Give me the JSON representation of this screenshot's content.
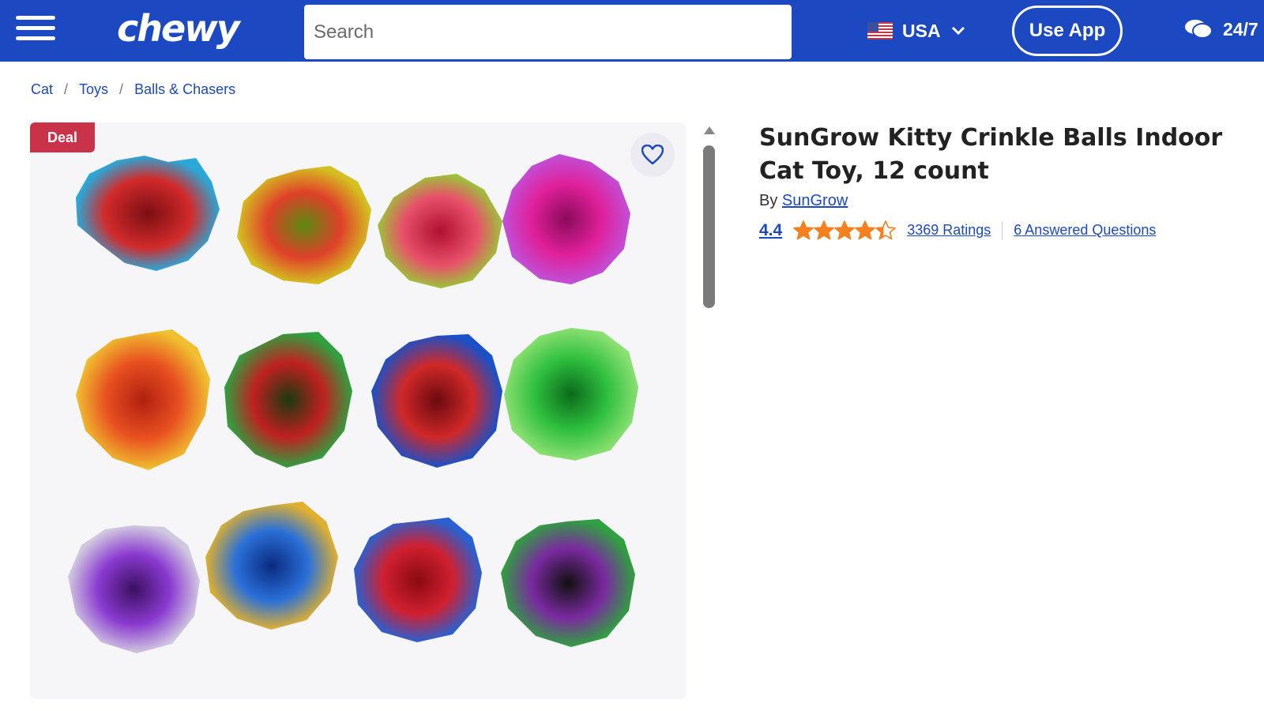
{
  "header": {
    "logo": "chewy",
    "search_placeholder": "Search",
    "country": "USA",
    "use_app": "Use App",
    "support": "24/7",
    "colors": {
      "brand": "#1c49c2"
    }
  },
  "breadcrumb": {
    "items": [
      "Cat",
      "Toys",
      "Balls & Chasers"
    ],
    "separator": "/"
  },
  "gallery": {
    "badge": "Deal"
  },
  "product": {
    "title": "SunGrow Kitty Crinkle Balls Indoor Cat Toy, 12 count",
    "by_label": "By",
    "brand": "SunGrow",
    "rating": "4.4",
    "rating_value": 4.4,
    "ratings_count": "3369 Ratings",
    "questions": "6 Answered Questions",
    "colors": {
      "star": "#f5801f"
    }
  }
}
